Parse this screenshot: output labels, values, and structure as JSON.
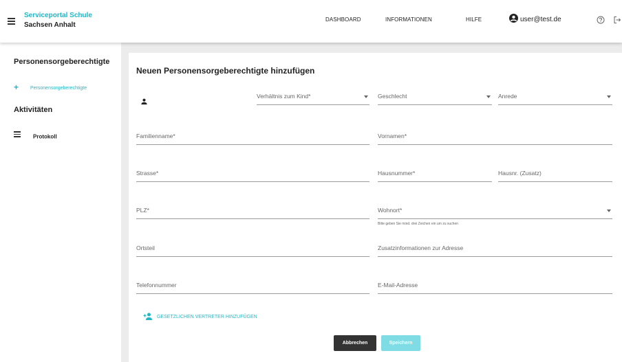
{
  "header": {
    "brand_line1": "Serviceportal Schule",
    "brand_line2": "Sachsen Anhalt",
    "nav": [
      "DASHBOARD",
      "INFORMATIONEN",
      "HILFE"
    ],
    "user": "user@test.de",
    "icons": [
      "menu-icon",
      "account-circle-icon",
      "help-icon",
      "logout-icon"
    ]
  },
  "sidebar": {
    "heading1": "Personensorgeberechtigte",
    "add_item": "Personensorgeberechtigte",
    "heading2": "Aktivitäten",
    "log_item": "Protokoll"
  },
  "form": {
    "title": "Neuen Personensorgeberechtigte hinzufügen",
    "relation": "Verhältnis zum Kind*",
    "gender": "Geschlecht",
    "salutation": "Anrede",
    "lastname": "Familienname*",
    "firstname": "Vornamen*",
    "street": "Strasse*",
    "housenumber": "Hausnummer*",
    "housenumber_extra": "Hausnr. (Zusatz)",
    "zip": "PLZ*",
    "city": "Wohnort*",
    "city_hint": "Bitte geben Sie mind. drei Zeichen ein um zu suchen",
    "district": "Ortsteil",
    "address_info": "Zusatzinformationen zur Adresse",
    "phone": "Telefonnummer",
    "email": "E-Mail-Adresse",
    "add_representative": "GESETZLICHEN VERTRETER HINZUFÜGEN",
    "cancel": "Abbrechen",
    "save": "Speichern"
  },
  "colors": {
    "accent": "#26b5c4",
    "save_disabled": "#7fdbe4",
    "cancel": "#333333"
  }
}
